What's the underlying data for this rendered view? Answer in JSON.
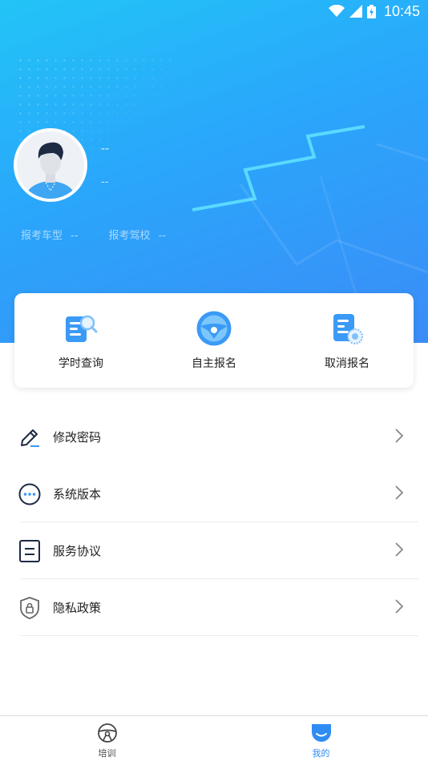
{
  "status_bar": {
    "time": "10:45"
  },
  "profile": {
    "name": "--",
    "subtitle": "--",
    "car_type_label": "报考车型",
    "car_type_value": "--",
    "school_label": "报考驾校",
    "school_value": "--"
  },
  "actions": [
    {
      "label": "学时查询",
      "icon": "study-hours-search-icon"
    },
    {
      "label": "自主报名",
      "icon": "steering-wheel-icon"
    },
    {
      "label": "取消报名",
      "icon": "cancel-registration-icon"
    }
  ],
  "menu": [
    {
      "label": "修改密码",
      "icon": "pencil-icon"
    },
    {
      "label": "系统版本",
      "icon": "more-dots-icon"
    },
    {
      "label": "服务协议",
      "icon": "document-icon"
    },
    {
      "label": "隐私政策",
      "icon": "shield-lock-icon"
    }
  ],
  "tabs": [
    {
      "label": "培训",
      "icon": "steering-wheel-icon",
      "active": false
    },
    {
      "label": "我的",
      "icon": "profile-icon",
      "active": true
    }
  ],
  "colors": {
    "accent": "#2f8cf3",
    "hero_start": "#22c4f7",
    "hero_end": "#3b8cf7"
  }
}
